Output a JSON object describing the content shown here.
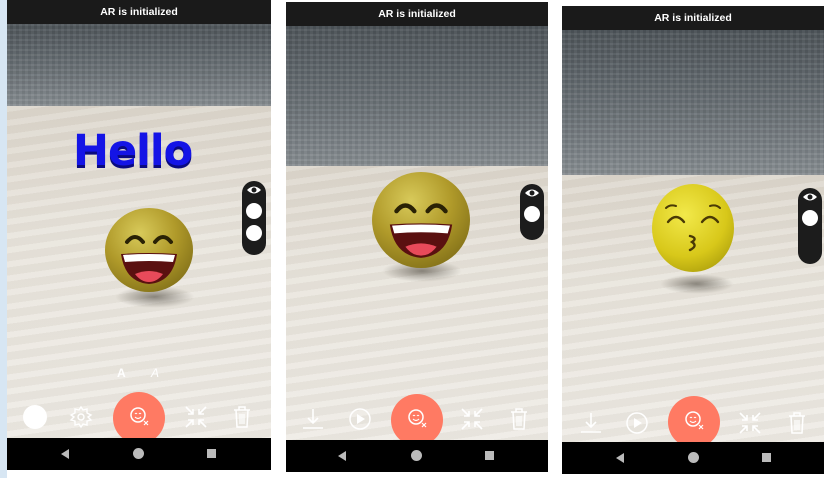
{
  "screens": [
    {
      "status": "AR is initialized",
      "overlay_text": "Hello",
      "emoji": "grinning-smiling-eyes",
      "font_options": [
        "A",
        "A"
      ],
      "toolbar": [
        "color-circle",
        "settings-icon",
        "emoji-record-button",
        "shrink-icon",
        "trash-icon"
      ]
    },
    {
      "status": "AR is initialized",
      "emoji": "grinning-smiling-eyes",
      "toolbar": [
        "download-icon",
        "play-icon",
        "emoji-record-button",
        "shrink-icon",
        "trash-icon"
      ]
    },
    {
      "status": "AR is initialized",
      "emoji": "kissing-smiling-eyes",
      "toolbar": [
        "download-icon",
        "play-icon",
        "emoji-record-button",
        "shrink-icon",
        "trash-icon"
      ]
    }
  ],
  "colors": {
    "accent": "#ff7a63",
    "text_blue": "#1414e6",
    "status_bar": "#1a1a1a"
  }
}
